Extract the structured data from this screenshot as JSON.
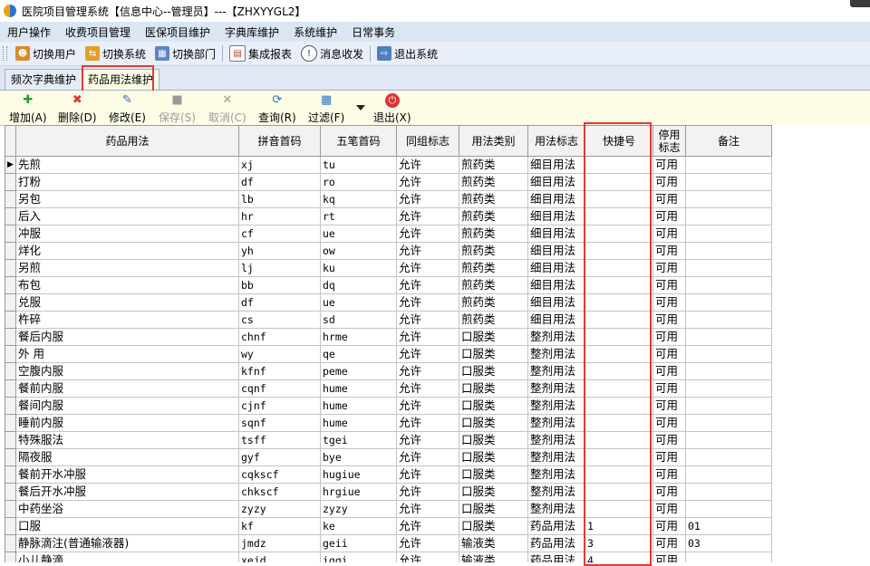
{
  "window": {
    "title": "医院项目管理系统【信息中心--管理员】---【ZHXYYGL2】"
  },
  "menu": [
    "用户操作",
    "收费项目管理",
    "医保项目维护",
    "字典库维护",
    "系统维护",
    "日常事务"
  ],
  "toolbar": [
    {
      "label": "切换用户",
      "icon": "switch-user-icon"
    },
    {
      "label": "切换系统",
      "icon": "switch-system-icon"
    },
    {
      "label": "切换部门",
      "icon": "switch-department-icon"
    },
    {
      "label": "集成报表",
      "icon": "report-icon"
    },
    {
      "label": "消息收发",
      "icon": "message-icon"
    },
    {
      "label": "退出系统",
      "icon": "exit-icon"
    }
  ],
  "tabs": [
    {
      "label": "频次字典维护",
      "active": false
    },
    {
      "label": "药品用法维护",
      "active": true
    }
  ],
  "actions": [
    {
      "label": "增加(A)",
      "icon": "add-icon",
      "enabled": true
    },
    {
      "label": "删除(D)",
      "icon": "delete-icon",
      "enabled": true
    },
    {
      "label": "修改(E)",
      "icon": "edit-icon",
      "enabled": true
    },
    {
      "label": "保存(S)",
      "icon": "save-icon",
      "enabled": false
    },
    {
      "label": "取消(C)",
      "icon": "cancel-icon",
      "enabled": false
    },
    {
      "label": "查询(R)",
      "icon": "query-icon",
      "enabled": true
    },
    {
      "label": "过滤(F)",
      "icon": "filter-icon",
      "enabled": true
    },
    {
      "label": "退出(X)",
      "icon": "power-icon",
      "enabled": true
    }
  ],
  "grid": {
    "columns": [
      "药品用法",
      "拼音首码",
      "五笔首码",
      "同组标志",
      "用法类别",
      "用法标志",
      "快捷号",
      "停用标志",
      "备注"
    ],
    "rows": [
      [
        "先煎",
        "xj",
        "tu",
        "允许",
        "煎药类",
        "细目用法",
        "",
        "可用",
        ""
      ],
      [
        "打粉",
        "df",
        "ro",
        "允许",
        "煎药类",
        "细目用法",
        "",
        "可用",
        ""
      ],
      [
        "另包",
        "lb",
        "kq",
        "允许",
        "煎药类",
        "细目用法",
        "",
        "可用",
        ""
      ],
      [
        "后入",
        "hr",
        "rt",
        "允许",
        "煎药类",
        "细目用法",
        "",
        "可用",
        ""
      ],
      [
        "冲服",
        "cf",
        "ue",
        "允许",
        "煎药类",
        "细目用法",
        "",
        "可用",
        ""
      ],
      [
        "烊化",
        "yh",
        "ow",
        "允许",
        "煎药类",
        "细目用法",
        "",
        "可用",
        ""
      ],
      [
        "另煎",
        "lj",
        "ku",
        "允许",
        "煎药类",
        "细目用法",
        "",
        "可用",
        ""
      ],
      [
        "布包",
        "bb",
        "dq",
        "允许",
        "煎药类",
        "细目用法",
        "",
        "可用",
        ""
      ],
      [
        "兑服",
        "df",
        "ue",
        "允许",
        "煎药类",
        "细目用法",
        "",
        "可用",
        ""
      ],
      [
        "杵碎",
        "cs",
        "sd",
        "允许",
        "煎药类",
        "细目用法",
        "",
        "可用",
        ""
      ],
      [
        "餐后内服",
        "chnf",
        "hrme",
        "允许",
        "口服类",
        "整剂用法",
        "",
        "可用",
        ""
      ],
      [
        "外 用",
        "wy",
        "qe",
        "允许",
        "口服类",
        "整剂用法",
        "",
        "可用",
        ""
      ],
      [
        "空腹内服",
        "kfnf",
        "peme",
        "允许",
        "口服类",
        "整剂用法",
        "",
        "可用",
        ""
      ],
      [
        "餐前内服",
        "cqnf",
        "hume",
        "允许",
        "口服类",
        "整剂用法",
        "",
        "可用",
        ""
      ],
      [
        "餐间内服",
        "cjnf",
        "hume",
        "允许",
        "口服类",
        "整剂用法",
        "",
        "可用",
        ""
      ],
      [
        "睡前内服",
        "sqnf",
        "hume",
        "允许",
        "口服类",
        "整剂用法",
        "",
        "可用",
        ""
      ],
      [
        "特殊服法",
        "tsff",
        "tgei",
        "允许",
        "口服类",
        "整剂用法",
        "",
        "可用",
        ""
      ],
      [
        "隔夜服",
        "gyf",
        "bye",
        "允许",
        "口服类",
        "整剂用法",
        "",
        "可用",
        ""
      ],
      [
        "餐前开水冲服",
        "cqkscf",
        "hugiue",
        "允许",
        "口服类",
        "整剂用法",
        "",
        "可用",
        ""
      ],
      [
        "餐后开水冲服",
        "chkscf",
        "hrgiue",
        "允许",
        "口服类",
        "整剂用法",
        "",
        "可用",
        ""
      ],
      [
        "中药坐浴",
        "zyzy",
        "zyzy",
        "允许",
        "口服类",
        "整剂用法",
        "",
        "可用",
        ""
      ],
      [
        "口服",
        "kf",
        "ke",
        "允许",
        "口服类",
        "药品用法",
        "1",
        "可用",
        "01"
      ],
      [
        "静脉滴注(普通输液器)",
        "jmdz",
        "geii",
        "允许",
        "输液类",
        "药品用法",
        "3",
        "可用",
        "03"
      ],
      [
        "小儿静滴",
        "xejd",
        "iggi",
        "允许",
        "输液类",
        "药品用法",
        "4",
        "可用",
        ""
      ]
    ]
  }
}
